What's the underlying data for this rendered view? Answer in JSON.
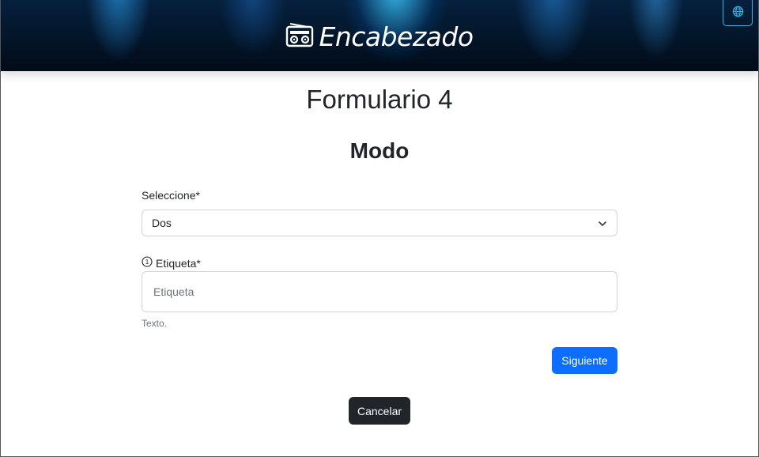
{
  "header": {
    "brand_text": "Encabezado",
    "brand_icon": "radio-icon",
    "language_icon": "globe-icon",
    "accent_color": "#2ab7e8"
  },
  "main": {
    "page_title": "Formulario 4",
    "section_title": "Modo",
    "select": {
      "label": "Seleccione*",
      "value": "Dos",
      "icon": "chevron-down-icon"
    },
    "label_field": {
      "label": "Etiqueta*",
      "info_icon": "info-circle-icon",
      "placeholder": "Etiqueta",
      "value": "",
      "help_text": "Texto."
    },
    "next_button": "Siguiente",
    "cancel_button": "Cancelar"
  },
  "colors": {
    "primary": "#0d6efd",
    "dark": "#212529",
    "muted": "#6c757d",
    "border": "#ced4da"
  }
}
